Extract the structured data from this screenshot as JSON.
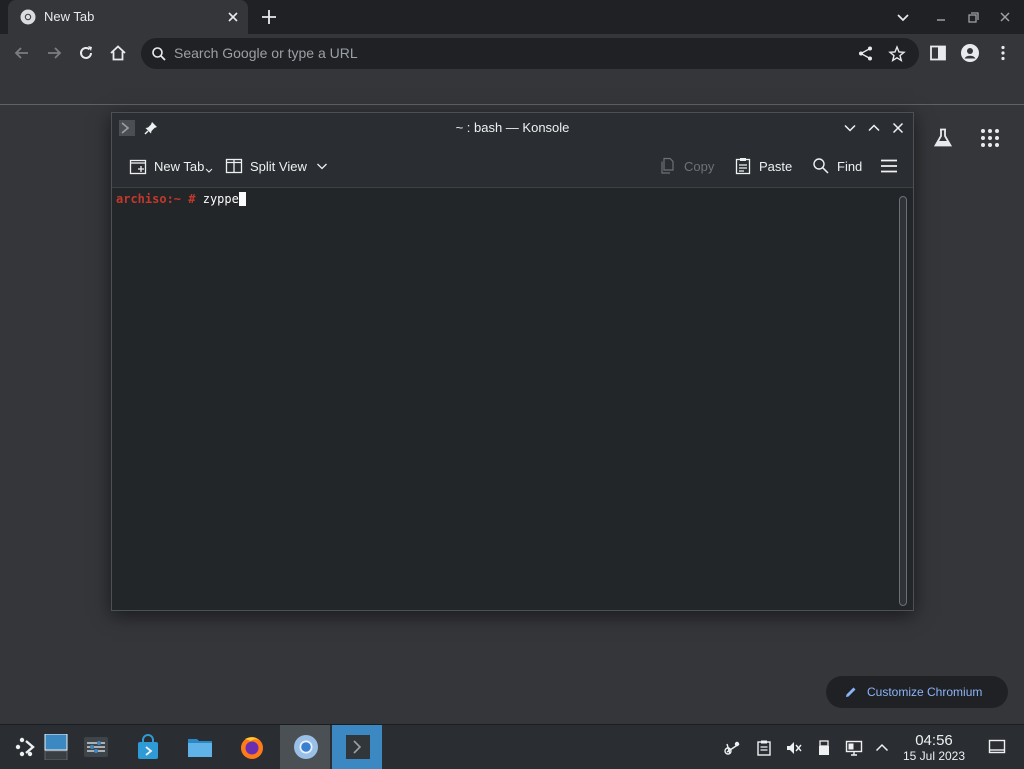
{
  "browser": {
    "tab": {
      "title": "New Tab"
    },
    "omnibox": {
      "placeholder": "Search Google or type a URL"
    },
    "customize_label": "Customize Chromium"
  },
  "konsole": {
    "title": "~ : bash — Konsole",
    "toolbar": {
      "new_tab": "New Tab",
      "split_view": "Split View",
      "copy": "Copy",
      "paste": "Paste",
      "find": "Find"
    },
    "prompt": {
      "host": "archiso",
      "path": ":~",
      "symbol": " # ",
      "command": "zyppe"
    }
  },
  "taskbar": {
    "apps": [
      "app-launcher",
      "desktop-pager",
      "system-settings",
      "discover-store",
      "dolphin-files",
      "firefox",
      "chromium",
      "konsole"
    ],
    "clock": {
      "time": "04:56",
      "date": "15 Jul 2023"
    }
  },
  "colors": {
    "prompt_red": "#c0392b",
    "accent_blue": "#3b88c3",
    "link_blue": "#8ab4f8"
  }
}
